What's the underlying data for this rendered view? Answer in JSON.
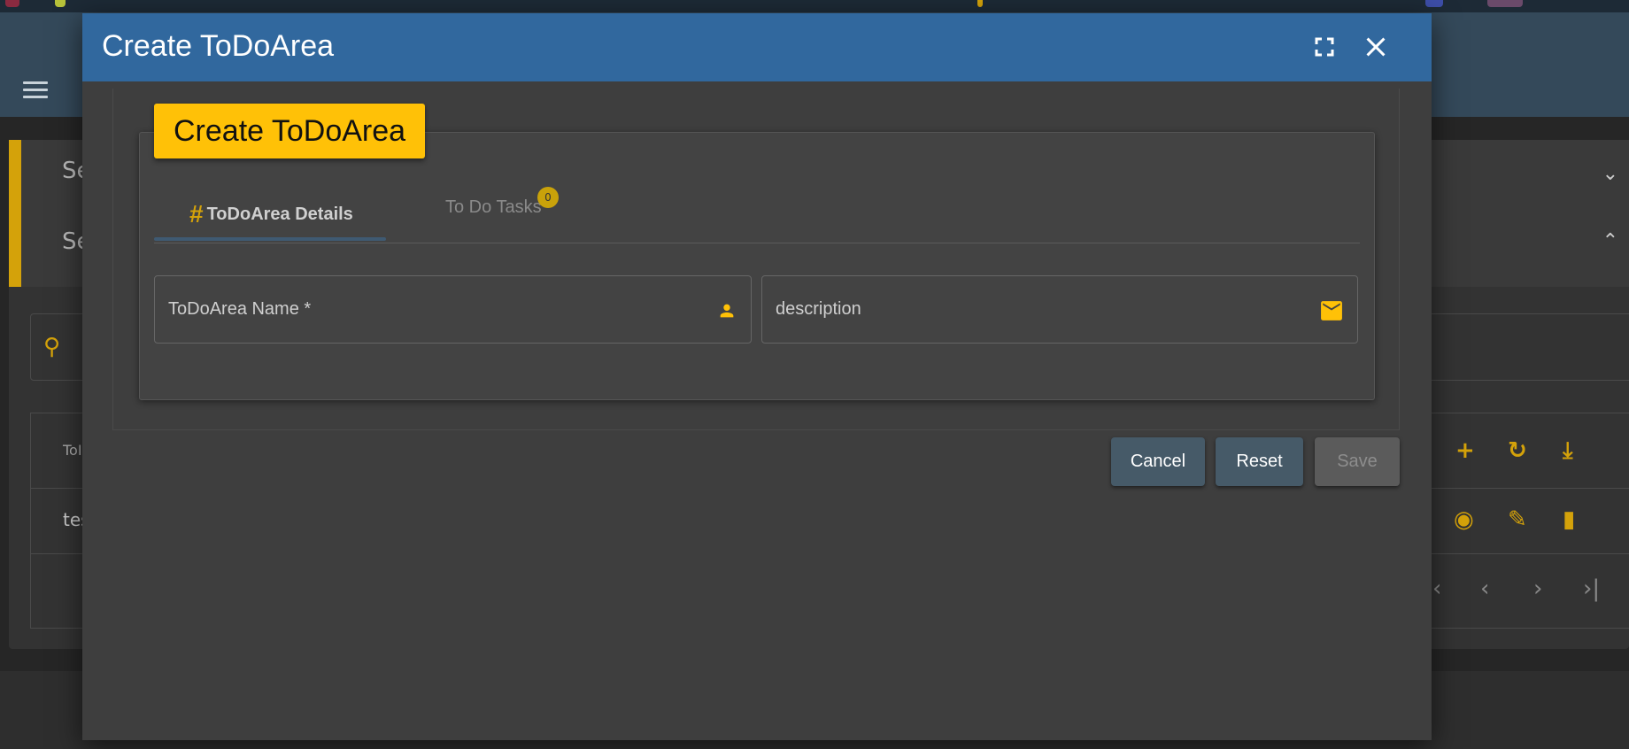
{
  "background": {
    "sections": [
      {
        "label": "Se",
        "chevron": "chevron-down"
      },
      {
        "label": "Se",
        "chevron": "chevron-up"
      }
    ],
    "search_icon": "search-icon",
    "table_header": "ToI",
    "table_row": "tes",
    "accent_color": "#d4a20a"
  },
  "dialog": {
    "title": "Create ToDoArea",
    "header_color": "#31689e",
    "fullscreen_icon": "fullscreen-icon",
    "close_icon": "close-icon",
    "card_title": "Create ToDoArea",
    "tabs": [
      {
        "label": "ToDoArea Details",
        "icon": "#",
        "active": true
      },
      {
        "label": "To Do Tasks",
        "badge": "0",
        "active": false
      }
    ],
    "fields": {
      "name": {
        "placeholder": "ToDoArea Name *",
        "icon": "person-icon"
      },
      "description": {
        "placeholder": "description",
        "icon": "mail-icon"
      }
    },
    "buttons": {
      "cancel": "Cancel",
      "reset": "Reset",
      "save": "Save"
    }
  }
}
